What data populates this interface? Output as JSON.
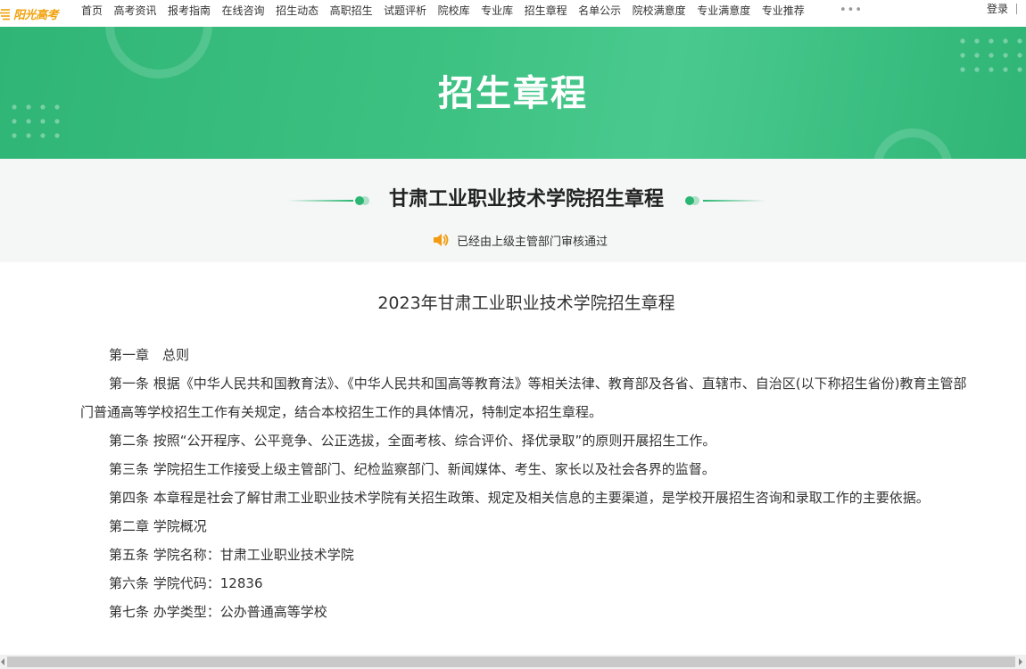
{
  "header": {
    "logo_text": "阳光高考",
    "nav_items": [
      "首页",
      "高考资讯",
      "报考指南",
      "在线咨询",
      "招生动态",
      "高职招生",
      "试题评析",
      "院校库",
      "专业库",
      "招生章程",
      "名单公示",
      "院校满意度",
      "专业满意度",
      "专业推荐"
    ],
    "more_label": "•••",
    "login_label": "登录"
  },
  "banner": {
    "title": "招生章程"
  },
  "subheader": {
    "title": "甘肃工业职业技术学院招生章程",
    "audit_text": "已经由上级主管部门审核通过"
  },
  "article": {
    "title": "2023年甘肃工业职业技术学院招生章程",
    "paragraphs": [
      "第一章　总则",
      "第一条  根据《中华人民共和国教育法》、《中华人民共和国高等教育法》等相关法律、教育部及各省、直辖市、自治区(以下称招生省份)教育主管部门普通高等学校招生工作有关规定，结合本校招生工作的具体情况，特制定本招生章程。",
      "第二条  按照“公开程序、公平竞争、公正选拔，全面考核、综合评价、择优录取”的原则开展招生工作。",
      "第三条  学院招生工作接受上级主管部门、纪检监察部门、新闻媒体、考生、家长以及社会各界的监督。",
      "第四条  本章程是社会了解甘肃工业职业技术学院有关招生政策、规定及相关信息的主要渠道，是学校开展招生咨询和录取工作的主要依据。",
      "第二章  学院概况",
      "第五条  学院名称：甘肃工业职业技术学院",
      "第六条  学院代码：12836",
      "第七条  办学类型：公办普通高等学校"
    ]
  },
  "colors": {
    "brand_green": "#2bb673",
    "logo_orange": "#f2a20c",
    "speaker_orange": "#f39c12"
  }
}
